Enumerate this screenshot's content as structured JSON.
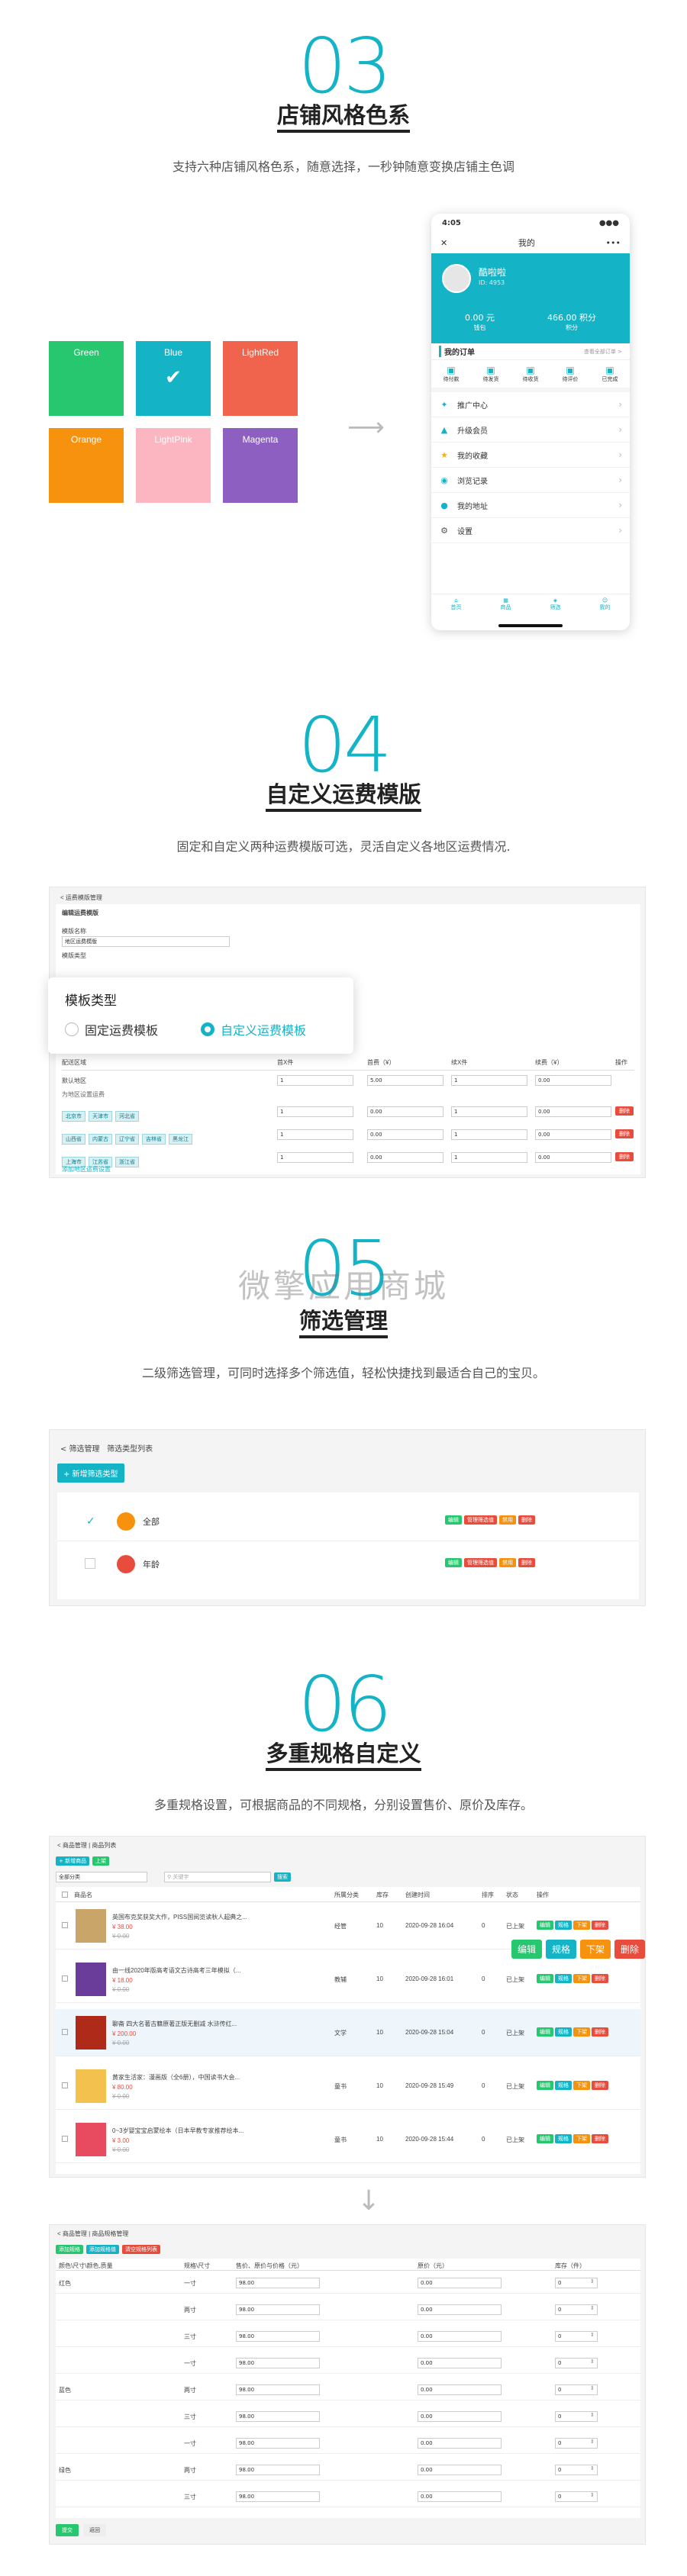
{
  "watermark": "微擎应用商城",
  "sec03": {
    "number": "03",
    "title": "店铺风格色系",
    "subtitle": "支持六种店铺风格色系，随意选择，一秒钟随意变换店铺主色调",
    "colors": [
      {
        "label": "Green",
        "color": "#27c770"
      },
      {
        "label": "Blue",
        "color": "#15b3c6"
      },
      {
        "label": "LightRed",
        "color": "#f0634d"
      },
      {
        "label": "Orange",
        "color": "#f7920f"
      },
      {
        "label": "LightPink",
        "color": "#fbb6c2"
      },
      {
        "label": "Magenta",
        "color": "#8c5fc0"
      }
    ],
    "phone": {
      "time": "4:05",
      "header_title": "我的",
      "nickname": "酷啦啦",
      "user_id": "ID: 4953",
      "balance_value": "0.00 元",
      "balance_label": "钱包",
      "points_value": "466.00 积分",
      "points_label": "积分",
      "orders_title": "我的订单",
      "orders_all": "查看全部订单 >",
      "order_items": [
        "待付款",
        "待发货",
        "待收货",
        "待评价",
        "已完成"
      ],
      "menu": [
        {
          "icon": "share-icon",
          "label": "推广中心"
        },
        {
          "icon": "user-up-icon",
          "label": "升级会员"
        },
        {
          "icon": "star-icon",
          "label": "我的收藏"
        },
        {
          "icon": "eye-icon",
          "label": "浏览记录"
        },
        {
          "icon": "location-icon",
          "label": "我的地址"
        },
        {
          "icon": "gear-icon",
          "label": "设置"
        }
      ],
      "tabs": [
        "首页",
        "商品",
        "筛选",
        "我的"
      ]
    }
  },
  "sec04": {
    "number": "04",
    "title": "自定义运费模版",
    "subtitle": "固定和自定义两种运费模版可选，灵活自定义各地区运费情况.",
    "breadcrumb": "< 运费模版管理",
    "form_title": "编辑运费模版",
    "name_label": "模版名称",
    "name_value": "地区运费模版",
    "type_label": "模版类型",
    "popup_title": "模板类型",
    "option_fixed": "固定运费模板",
    "option_custom": "自定义运费模板",
    "table_headers": [
      "配送区域",
      "首X件",
      "首费（¥）",
      "续X件",
      "续费（¥）",
      "操作"
    ],
    "default_label": "默认地区",
    "default_row": [
      "1",
      "5.00",
      "1",
      "0.00"
    ],
    "region_note": "为地区设置运费",
    "rows": [
      {
        "tags": [
          "北京市",
          "天津市",
          "河北省"
        ],
        "vals": [
          "1",
          "0.00",
          "1",
          "0.00"
        ]
      },
      {
        "tags": [
          "山西省",
          "内蒙古",
          "辽宁省",
          "吉林省",
          "黑龙江"
        ],
        "vals": [
          "1",
          "0.00",
          "1",
          "0.00"
        ]
      },
      {
        "tags": [
          "上海市",
          "江苏省",
          "浙江省"
        ],
        "vals": [
          "1",
          "0.00",
          "1",
          "0.00"
        ]
      }
    ],
    "delete": "删除",
    "add_link": "添加地区运费设置"
  },
  "sec05": {
    "number": "05",
    "title": "筛选管理",
    "subtitle": "二级筛选管理，可同时选择多个筛选值，轻松快捷找到最适合自己的宝贝。",
    "breadcrumb_back": "< 筛选管理",
    "breadcrumb_current": "筛选类型列表",
    "add_button": "+ 新增筛选类型",
    "items": [
      {
        "label": "全部",
        "checked": true,
        "badge_color": "#f7920f"
      },
      {
        "label": "年龄",
        "checked": false,
        "badge_color": "#e74c3c"
      }
    ],
    "actions": [
      "编辑",
      "管理筛选值",
      "禁用",
      "删除"
    ]
  },
  "sec06": {
    "number": "06",
    "title": "多重规格自定义",
    "subtitle": "多重规格设置，可根据商品的不同规格，分别设置售价、原价及库存。",
    "breadcrumb": "< 商品管理 | 商品列表",
    "add_button": "+ 新增商品",
    "sort_button": "上架",
    "filter_select": "全部分类",
    "search_placeholder": "关键字",
    "search_button": "搜索",
    "headers": [
      "商品名",
      "所属分类",
      "库存",
      "创建时间",
      "排序",
      "状态",
      "操作"
    ],
    "products": [
      {
        "name": "英国布克奖获奖大作，PISS国阅览读秋人超典之...",
        "price": "¥ 38.00",
        "orig": "¥ 0.00",
        "cat": "经管",
        "stock": "10",
        "time": "2020-09-28 16:04",
        "sort": "0",
        "status": "已上架",
        "cover": "#c9a56a"
      },
      {
        "name": "由一线2020年版高考语文古诗高考三年模拟（...",
        "price": "¥ 18.00",
        "orig": "¥ 0.00",
        "cat": "教辅",
        "stock": "10",
        "time": "2020-09-28 16:01",
        "sort": "0",
        "status": "已上架",
        "cover": "#6a3d9a"
      },
      {
        "name": "聊斋 四大名著古籍原著正版无删减 水浒传红...",
        "price": "¥ 200.00",
        "orig": "¥ 0.00",
        "cat": "文学",
        "stock": "10",
        "time": "2020-09-28 15:04",
        "sort": "0",
        "status": "已上架",
        "cover": "#b02a1a"
      },
      {
        "name": "黄家生活家：漫画版（全6册），中国读书大会...",
        "price": "¥ 80.00",
        "orig": "¥ 0.00",
        "cat": "童书",
        "stock": "10",
        "time": "2020-09-28 15:49",
        "sort": "0",
        "status": "已上架",
        "cover": "#f2c14e"
      },
      {
        "name": "0~3岁婴宝宝启蒙绘本（日本早教专家推荐绘本...",
        "price": "¥ 3.00",
        "orig": "¥ 0.00",
        "cat": "童书",
        "stock": "10",
        "time": "2020-09-28 15:44",
        "sort": "0",
        "status": "已上架",
        "cover": "#e84a5f"
      }
    ],
    "row_actions": [
      "编辑",
      "规格",
      "下架",
      "删除"
    ],
    "big_actions": [
      "编辑",
      "规格",
      "下架",
      "删除"
    ],
    "sku": {
      "breadcrumb": "< 商品管理 | 商品规格管理",
      "buttons": [
        "添加规格",
        "添加规格值",
        "清空规格列表"
      ],
      "headers": [
        "颜色\\尺寸\\颜色,质量",
        "规格\\尺寸",
        "售价、原价与价格（元）",
        "原价（元）",
        "库存（件）"
      ],
      "groups": [
        {
          "name": "红色",
          "sizes": [
            "一寸",
            "两寸",
            "三寸"
          ]
        },
        {
          "name": "蓝色",
          "sizes": [
            "一寸",
            "两寸",
            "三寸"
          ]
        },
        {
          "name": "绿色",
          "sizes": [
            "一寸",
            "两寸",
            "三寸"
          ]
        }
      ],
      "price": "98.00",
      "orig": "0.00",
      "stock": "0",
      "submit": "提交",
      "back": "返回"
    }
  }
}
